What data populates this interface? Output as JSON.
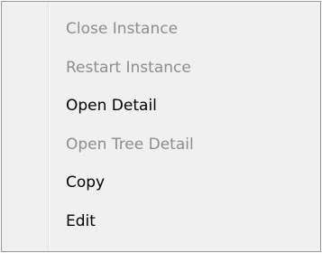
{
  "context_menu": {
    "items": [
      {
        "label": "Close Instance",
        "enabled": false
      },
      {
        "label": "Restart Instance",
        "enabled": false
      },
      {
        "label": "Open Detail",
        "enabled": true
      },
      {
        "label": "Open Tree Detail",
        "enabled": false
      },
      {
        "label": "Copy",
        "enabled": true
      },
      {
        "label": "Edit",
        "enabled": true
      }
    ]
  },
  "colors": {
    "background": "#f0f0f0",
    "border": "#979797",
    "text_enabled": "#000000",
    "text_disabled": "#8d8d8d"
  }
}
